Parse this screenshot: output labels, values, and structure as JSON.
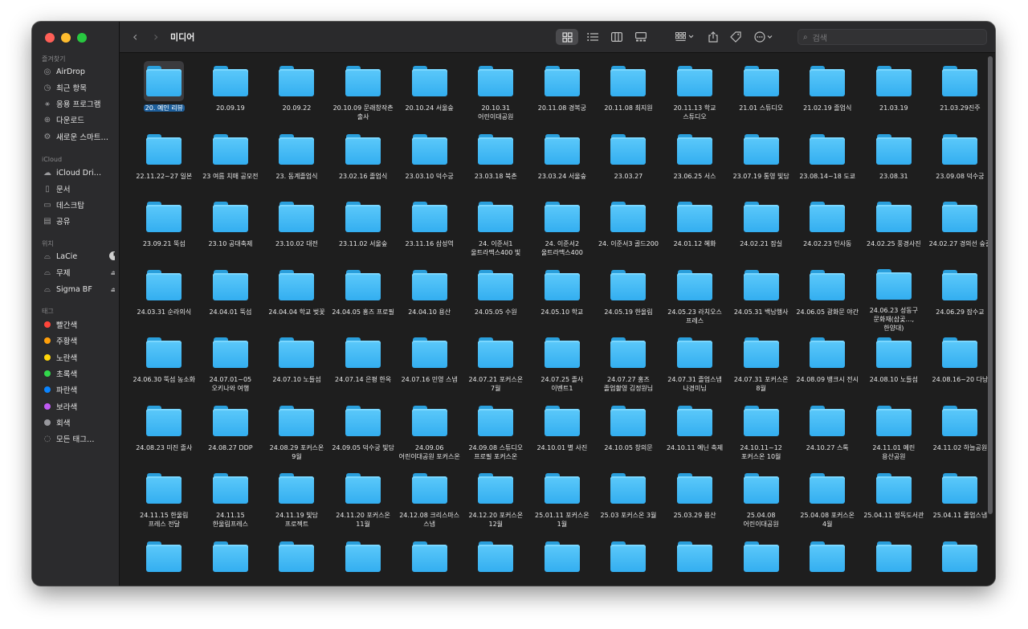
{
  "window": {
    "title": "미디어"
  },
  "sidebar": {
    "sections": {
      "favorites": "즐겨찾기",
      "icloud": "iCloud",
      "locations": "위치",
      "tags": "태그"
    },
    "favorites": [
      {
        "label": "AirDrop",
        "icon": "airdrop-icon"
      },
      {
        "label": "최근 항목",
        "icon": "clock-icon"
      },
      {
        "label": "응용 프로그램",
        "icon": "apps-icon"
      },
      {
        "label": "다운로드",
        "icon": "download-icon"
      },
      {
        "label": "새로운 스마트…",
        "icon": "gear-icon"
      }
    ],
    "icloud": [
      {
        "label": "iCloud Dri…",
        "icon": "cloud-icon"
      },
      {
        "label": "문서",
        "icon": "document-icon"
      },
      {
        "label": "데스크탑",
        "icon": "desktop-icon"
      },
      {
        "label": "공유",
        "icon": "shared-folder-icon"
      }
    ],
    "locations": [
      {
        "label": "LaCie",
        "icon": "drive-icon"
      },
      {
        "label": "무제",
        "icon": "drive-icon"
      },
      {
        "label": "Sigma BF",
        "icon": "drive-icon"
      }
    ],
    "tags": [
      {
        "label": "빨간색",
        "color": "#ff453a"
      },
      {
        "label": "주황색",
        "color": "#ff9f0a"
      },
      {
        "label": "노란색",
        "color": "#ffd60a"
      },
      {
        "label": "초록색",
        "color": "#32d74b"
      },
      {
        "label": "파란색",
        "color": "#0a84ff"
      },
      {
        "label": "보라색",
        "color": "#bf5af2"
      },
      {
        "label": "회색",
        "color": "#98989d"
      },
      {
        "label": "모든 태그…",
        "color": ""
      }
    ]
  },
  "toolbar": {
    "back": "‹",
    "forward": "›",
    "search_placeholder": "검색"
  },
  "accent": "#1d5e9a",
  "files": [
    "20. 예인 리뷰",
    "20.09.19",
    "20.09.22",
    "20.10.09 문래창작촌 출사",
    "20.10.24 서울숲",
    "20.10.31 어린이대공원",
    "20.11.08 경복궁",
    "20.11.08 최지원",
    "20.11.13 학교 스튜디오",
    "21.01 스튜디오",
    "21.02.19 졸업식",
    "21.03.19",
    "21.03.29진주",
    "22.11.22~27 일본",
    "23 여름 치매 공모전",
    "23. 동계졸업식",
    "23.02.16 졸업식",
    "23.03.10 덕수궁",
    "23.03.18 북촌",
    "23.03.24 서울숲",
    "23.03.27",
    "23.06.25 서스",
    "23.07.19 통영 빛담",
    "23.08.14~18 도쿄",
    "23.08.31",
    "23.09.08 덕수궁",
    "23.09.21 뚝섬",
    "23.10 공대축제",
    "23.10.02 대전",
    "23.11.02 서울숲",
    "23.11.16 삼성역",
    "24. 이준서1 울트라맥스400 빛",
    "24. 이준서2 울트라맥스400",
    "24. 이준서3 골드200",
    "24.01.12 혜화",
    "24.02.21 잠실",
    "24.02.23 인사동",
    "24.02.25 풍경사진",
    "24.02.27 경의선 숲길",
    "24.03.31 순라의식",
    "24.04.01 뚝섬",
    "24.04.04 학교 벚꽃",
    "24.04.05 홍즈 프로필",
    "24.04.10 용산",
    "24.05.05 수원",
    "24.05.10 학교",
    "24.05.19 한올림",
    "24.05.23 라치오스 프레스",
    "24.05.31 백남행사",
    "24.06.05 광화문 야간",
    "24.06.23 성동구 문화재(삼곶…, 한양대)",
    "24.06.29 잠수교",
    "24.06.30 뚝섬 농소화",
    "24.07.01~05 오키나와 여행",
    "24.07.10 노들섬",
    "24.07.14 은평 한옥",
    "24.07.16 민영 스냅",
    "24.07.21 포커스온 7월",
    "24.07.25 졸사 이벤트1",
    "24.07.27 홍즈 졸업촬영 김정원님",
    "24.07.31 졸업스냅 나경미님",
    "24.07.31 포커스온 8월",
    "24.08.09 뱅크시 전시",
    "24.08.10 노들섬",
    "24.08.16~20 다낭",
    "24.08.23 미진 졸사",
    "24.08.27 DDP",
    "24.08.29 포커스온 9월",
    "24.09.05 덕수궁 빛담",
    "24.09.06 어린이대공원 포커스온",
    "24.09.08 스튜디오 프로필 포커스온",
    "24.10.01 별 사진",
    "24.10.05 창의문",
    "24.10.11 예닌 축제",
    "24.10.11~12 포커스온 10월",
    "24.10.27 스톡",
    "24.11.01 예린 용산공원",
    "24.11.02 하늘공원",
    "24.11.15 한울림 프레스 전달",
    "24.11.15 한울림프레스",
    "24.11.19 빛담 프로젝트",
    "24.11.20 포커스온 11월",
    "24.12.08 크리스마스 스냅",
    "24.12.20 포커스온 12월",
    "25.01.11 포커스온 1월",
    "25.03 포커스온 3월",
    "25.03.29 용산",
    "25.04.08 어린이대공원",
    "25.04.08 포커스온 4월",
    "25.04.11 정독도서관",
    "25.04.11 졸업스냅",
    "",
    "",
    "",
    "",
    "",
    "",
    "",
    "",
    "",
    "",
    "",
    "",
    ""
  ]
}
